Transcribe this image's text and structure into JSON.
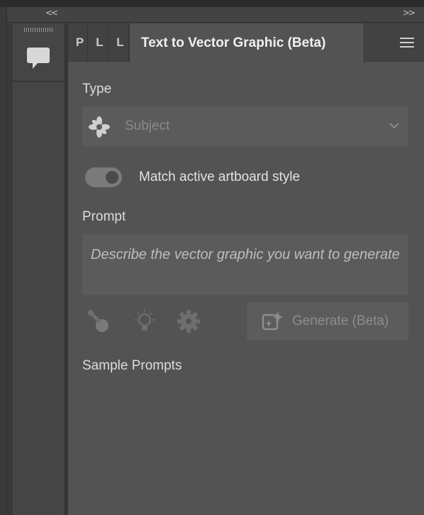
{
  "window": {
    "collapse_left": "<<",
    "collapse_right": ">>"
  },
  "dock": {
    "comments_icon": "speech-bubble-icon"
  },
  "tabs": {
    "stubs": [
      "P",
      "L",
      "L"
    ],
    "active_label": "Text to Vector Graphic (Beta)",
    "menu_icon": "hamburger-menu-icon"
  },
  "type_section": {
    "label": "Type",
    "selected": "Subject",
    "icon": "flower-icon"
  },
  "match_style": {
    "label": "Match active artboard style",
    "enabled": true
  },
  "prompt_section": {
    "label": "Prompt",
    "placeholder": "Describe the vector graphic you want to generate"
  },
  "toolbar": {
    "icons": [
      "color-picker-icon",
      "lightbulb-icon",
      "gear-icon"
    ],
    "generate_label": "Generate (Beta)"
  },
  "samples": {
    "label": "Sample Prompts"
  }
}
